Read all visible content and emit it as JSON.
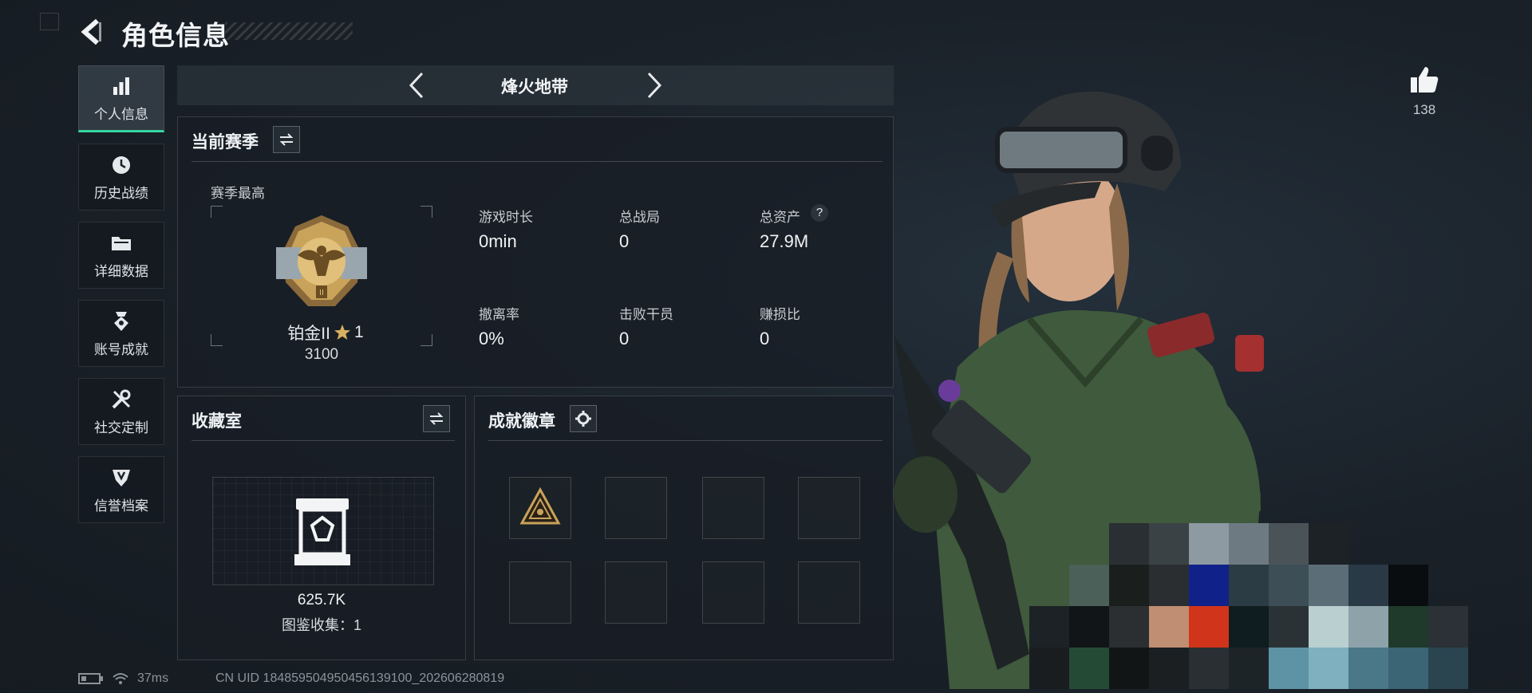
{
  "header": {
    "title": "角色信息"
  },
  "nav": {
    "items": [
      {
        "label": "个人信息",
        "icon": "bar-chart-icon",
        "active": true
      },
      {
        "label": "历史战绩",
        "icon": "history-clock-icon",
        "active": false
      },
      {
        "label": "详细数据",
        "icon": "folder-icon",
        "active": false
      },
      {
        "label": "账号成就",
        "icon": "achievement-medal-icon",
        "active": false
      },
      {
        "label": "社交定制",
        "icon": "wrench-tools-icon",
        "active": false
      },
      {
        "label": "信誉档案",
        "icon": "credit-shield-icon",
        "active": false
      }
    ]
  },
  "mode": {
    "label": "烽火地带"
  },
  "season": {
    "title": "当前赛季",
    "best_label": "赛季最高",
    "rank_name": "铂金II",
    "rank_stars": "1",
    "rank_score": "3100",
    "stats": [
      {
        "label": "游戏时长",
        "value": "0min"
      },
      {
        "label": "总战局",
        "value": "0"
      },
      {
        "label": "总资产",
        "value": "27.9M"
      },
      {
        "label": "撤离率",
        "value": "0%"
      },
      {
        "label": "击败干员",
        "value": "0"
      },
      {
        "label": "赚损比",
        "value": "0"
      }
    ],
    "help_symbol": "?"
  },
  "collection": {
    "title": "收藏室",
    "value": "625.7K",
    "catalog_label": "图鉴收集：1"
  },
  "achievements": {
    "title": "成就徽章"
  },
  "like": {
    "count": "138"
  },
  "status": {
    "ping": "37ms",
    "uid": "CN UID 1848595049504561391­00_202606280819"
  },
  "colors": {
    "accent": "#36d6a0",
    "gold": "#c9a35a",
    "background": "#1a2129"
  }
}
